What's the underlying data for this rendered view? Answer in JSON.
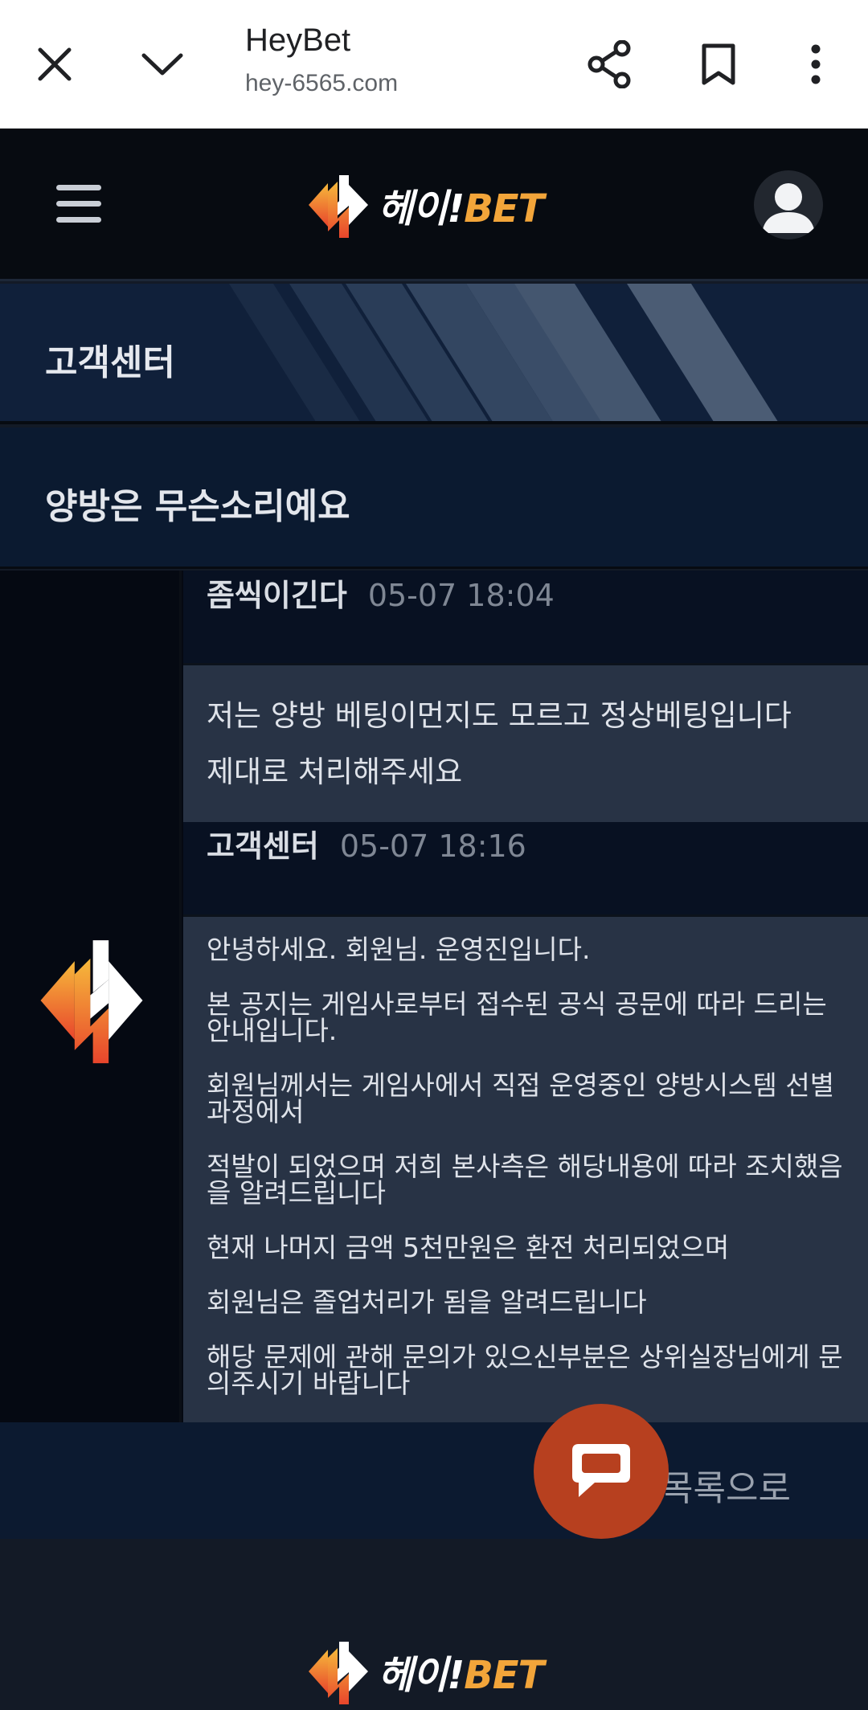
{
  "browser": {
    "title": "HeyBet",
    "url": "hey-6565.com",
    "icons": [
      "close-icon",
      "chevron-down-icon",
      "share-icon",
      "bookmark-icon",
      "more-vert-icon"
    ]
  },
  "site": {
    "logo_main": "헤이!",
    "logo_accent": "BET",
    "accent_color": "#f2a53a",
    "orange_color": "#e8532c"
  },
  "banner": {
    "title": "고객센터"
  },
  "post": {
    "title": "양방은 무슨소리예요"
  },
  "conversation": {
    "user": {
      "author": "좀씩이긴다",
      "time": "05-07 18:04",
      "lines": [
        "저는 양방 베팅이먼지도 모르고 정상베팅입니다",
        "제대로 처리해주세요"
      ]
    },
    "reply": {
      "author": "고객센터",
      "time": "05-07 18:16",
      "lines": [
        "안녕하세요. 회원님. 운영진입니다.",
        "본 공지는 게임사로부터 접수된 공식 공문에 따라 드리는",
        "안내입니다.",
        "회원님께서는 게임사에서 직접 운영중인 양방시스템 선별",
        "과정에서",
        "적발이 되었으며 저희 본사측은 해당내용에 따라 조치했음",
        "을 알려드립니다",
        "현재 나머지 금액 5천만원은 환전 처리되었으며",
        "회원님은 졸업처리가 됨을 알려드립니다",
        "해당 문제에 관해 문의가 있으신부분은 상위실장님에게 문",
        "의주시기 바랍니다"
      ]
    }
  },
  "list_button": {
    "label": "목록으로"
  },
  "chat_button_color": "#b7401f"
}
